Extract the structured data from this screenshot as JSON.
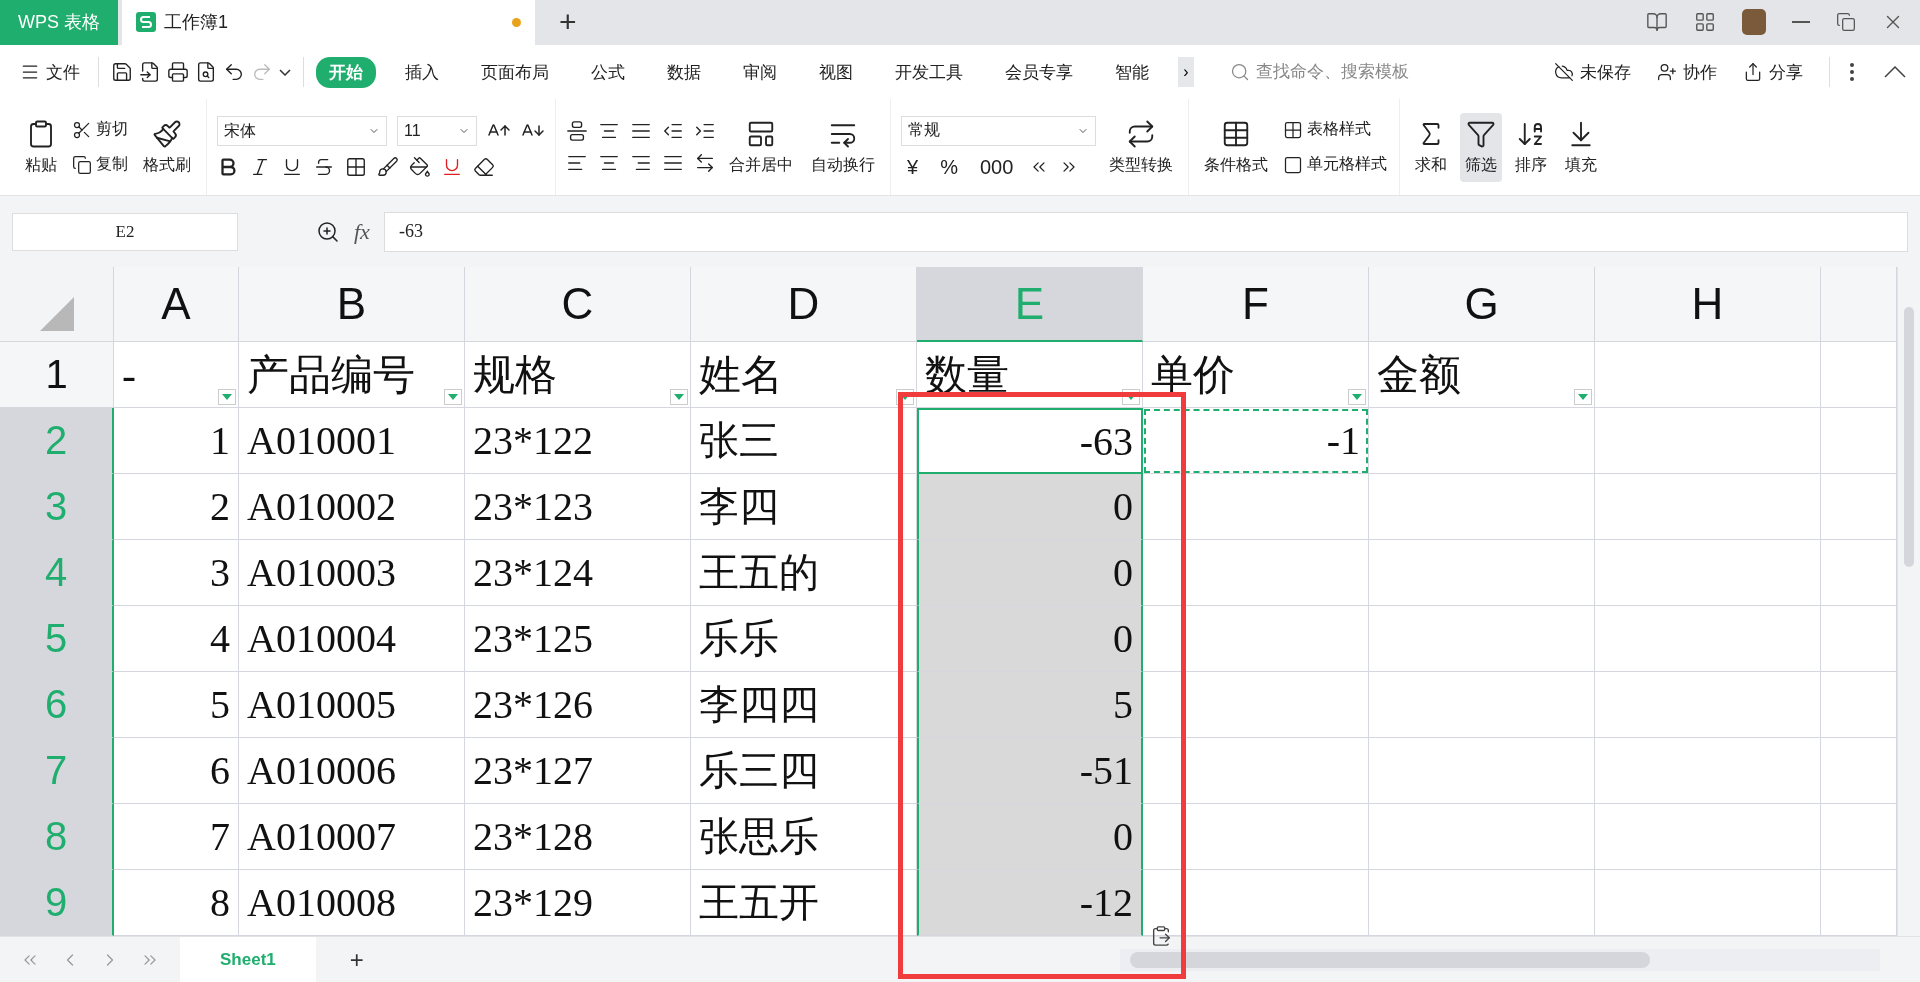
{
  "title_bar": {
    "app_tab": "WPS 表格",
    "doc_tab": {
      "title": "工作簿1",
      "unsaved": true
    },
    "new_tab": "+"
  },
  "menu": {
    "file": "文件",
    "tabs": [
      {
        "label": "开始",
        "selected": true
      },
      {
        "label": "插入",
        "selected": false
      },
      {
        "label": "页面布局",
        "selected": false
      },
      {
        "label": "公式",
        "selected": false
      },
      {
        "label": "数据",
        "selected": false
      },
      {
        "label": "审阅",
        "selected": false
      },
      {
        "label": "视图",
        "selected": false
      },
      {
        "label": "开发工具",
        "selected": false
      },
      {
        "label": "会员专享",
        "selected": false
      },
      {
        "label": "智能",
        "selected": false
      }
    ],
    "more": "›",
    "search": {
      "placeholder": "查找命令、搜索模板"
    },
    "actions": [
      "未保存",
      "协作",
      "分享"
    ]
  },
  "ribbon": {
    "clipboard": {
      "paste": "粘贴",
      "cut": "剪切",
      "copy": "复制",
      "format_painter": "格式刷"
    },
    "font": {
      "name": "宋体",
      "size": "11"
    },
    "alignment": {
      "merge": "合并居中",
      "wrap": "自动换行"
    },
    "number": {
      "format": "常规",
      "currency": "¥",
      "percent": "%",
      "thousands": "000",
      "convert": "类型转换"
    },
    "styles": {
      "conditional": "条件格式",
      "table_style": "表格样式",
      "cell_style": "单元格样式"
    },
    "editing": [
      {
        "label": "求和",
        "selected": false
      },
      {
        "label": "筛选",
        "selected": true
      },
      {
        "label": "排序",
        "selected": false
      },
      {
        "label": "填充",
        "selected": false
      }
    ]
  },
  "formula_bar": {
    "name_box": "E2",
    "fx": "fx",
    "value": "-63"
  },
  "table": {
    "columns": [
      {
        "label": "A",
        "selected": false
      },
      {
        "label": "B",
        "selected": false
      },
      {
        "label": "C",
        "selected": false
      },
      {
        "label": "D",
        "selected": false
      },
      {
        "label": "E",
        "selected": true
      },
      {
        "label": "F",
        "selected": false
      },
      {
        "label": "G",
        "selected": false
      },
      {
        "label": "H",
        "selected": false
      }
    ],
    "header_row": {
      "number": "1",
      "cells": [
        {
          "text": "-",
          "filter": true
        },
        {
          "text": "产品编号",
          "filter": true
        },
        {
          "text": "规格",
          "filter": true
        },
        {
          "text": "姓名",
          "filter": true
        },
        {
          "text": "数量",
          "filter": true
        },
        {
          "text": "单价",
          "filter": true
        },
        {
          "text": "金额",
          "filter": true
        },
        {
          "filter": false
        }
      ]
    },
    "rows": [
      {
        "number": "2",
        "selected": true,
        "cells": [
          {
            "text": "1",
            "kind": "number",
            "selected": false,
            "active": false,
            "copied": false
          },
          {
            "text": "A010001",
            "kind": "text",
            "selected": false,
            "active": false,
            "copied": false
          },
          {
            "text": "23*122",
            "kind": "text",
            "selected": false,
            "active": false,
            "copied": false
          },
          {
            "text": "张三",
            "kind": "text",
            "selected": false,
            "active": false,
            "copied": false
          },
          {
            "text": "-63",
            "kind": "number",
            "selected": true,
            "active": true,
            "copied": false
          },
          {
            "text": "-1",
            "kind": "number",
            "selected": false,
            "active": false,
            "copied": true
          },
          {
            "kind": "text",
            "selected": false,
            "active": false,
            "copied": false
          },
          {
            "kind": "text",
            "selected": false,
            "active": false,
            "copied": false
          }
        ]
      },
      {
        "number": "3",
        "selected": true,
        "cells": [
          {
            "text": "2",
            "kind": "number",
            "selected": false,
            "active": false,
            "copied": false
          },
          {
            "text": "A010002",
            "kind": "text",
            "selected": false,
            "active": false,
            "copied": false
          },
          {
            "text": "23*123",
            "kind": "text",
            "selected": false,
            "active": false,
            "copied": false
          },
          {
            "text": "李四",
            "kind": "text",
            "selected": false,
            "active": false,
            "copied": false
          },
          {
            "text": "0",
            "kind": "number",
            "selected": true,
            "active": false,
            "copied": false
          },
          {
            "kind": "text",
            "selected": false,
            "active": false,
            "copied": false
          },
          {
            "kind": "text",
            "selected": false,
            "active": false,
            "copied": false
          },
          {
            "kind": "text",
            "selected": false,
            "active": false,
            "copied": false
          }
        ]
      },
      {
        "number": "4",
        "selected": true,
        "cells": [
          {
            "text": "3",
            "kind": "number",
            "selected": false,
            "active": false,
            "copied": false
          },
          {
            "text": "A010003",
            "kind": "text",
            "selected": false,
            "active": false,
            "copied": false
          },
          {
            "text": "23*124",
            "kind": "text",
            "selected": false,
            "active": false,
            "copied": false
          },
          {
            "text": "王五的",
            "kind": "text",
            "selected": false,
            "active": false,
            "copied": false
          },
          {
            "text": "0",
            "kind": "number",
            "selected": true,
            "active": false,
            "copied": false
          },
          {
            "kind": "text",
            "selected": false,
            "active": false,
            "copied": false
          },
          {
            "kind": "text",
            "selected": false,
            "active": false,
            "copied": false
          },
          {
            "kind": "text",
            "selected": false,
            "active": false,
            "copied": false
          }
        ]
      },
      {
        "number": "5",
        "selected": true,
        "cells": [
          {
            "text": "4",
            "kind": "number",
            "selected": false,
            "active": false,
            "copied": false
          },
          {
            "text": "A010004",
            "kind": "text",
            "selected": false,
            "active": false,
            "copied": false
          },
          {
            "text": "23*125",
            "kind": "text",
            "selected": false,
            "active": false,
            "copied": false
          },
          {
            "text": "乐乐",
            "kind": "text",
            "selected": false,
            "active": false,
            "copied": false
          },
          {
            "text": "0",
            "kind": "number",
            "selected": true,
            "active": false,
            "copied": false
          },
          {
            "kind": "text",
            "selected": false,
            "active": false,
            "copied": false
          },
          {
            "kind": "text",
            "selected": false,
            "active": false,
            "copied": false
          },
          {
            "kind": "text",
            "selected": false,
            "active": false,
            "copied": false
          }
        ]
      },
      {
        "number": "6",
        "selected": true,
        "cells": [
          {
            "text": "5",
            "kind": "number",
            "selected": false,
            "active": false,
            "copied": false
          },
          {
            "text": "A010005",
            "kind": "text",
            "selected": false,
            "active": false,
            "copied": false
          },
          {
            "text": "23*126",
            "kind": "text",
            "selected": false,
            "active": false,
            "copied": false
          },
          {
            "text": "李四四",
            "kind": "text",
            "selected": false,
            "active": false,
            "copied": false
          },
          {
            "text": "5",
            "kind": "number",
            "selected": true,
            "active": false,
            "copied": false
          },
          {
            "kind": "text",
            "selected": false,
            "active": false,
            "copied": false
          },
          {
            "kind": "text",
            "selected": false,
            "active": false,
            "copied": false
          },
          {
            "kind": "text",
            "selected": false,
            "active": false,
            "copied": false
          }
        ]
      },
      {
        "number": "7",
        "selected": true,
        "cells": [
          {
            "text": "6",
            "kind": "number",
            "selected": false,
            "active": false,
            "copied": false
          },
          {
            "text": "A010006",
            "kind": "text",
            "selected": false,
            "active": false,
            "copied": false
          },
          {
            "text": "23*127",
            "kind": "text",
            "selected": false,
            "active": false,
            "copied": false
          },
          {
            "text": "乐三四",
            "kind": "text",
            "selected": false,
            "active": false,
            "copied": false
          },
          {
            "text": "-51",
            "kind": "number",
            "selected": true,
            "active": false,
            "copied": false
          },
          {
            "kind": "text",
            "selected": false,
            "active": false,
            "copied": false
          },
          {
            "kind": "text",
            "selected": false,
            "active": false,
            "copied": false
          },
          {
            "kind": "text",
            "selected": false,
            "active": false,
            "copied": false
          }
        ]
      },
      {
        "number": "8",
        "selected": true,
        "cells": [
          {
            "text": "7",
            "kind": "number",
            "selected": false,
            "active": false,
            "copied": false
          },
          {
            "text": "A010007",
            "kind": "text",
            "selected": false,
            "active": false,
            "copied": false
          },
          {
            "text": "23*128",
            "kind": "text",
            "selected": false,
            "active": false,
            "copied": false
          },
          {
            "text": "张思乐",
            "kind": "text",
            "selected": false,
            "active": false,
            "copied": false
          },
          {
            "text": "0",
            "kind": "number",
            "selected": true,
            "active": false,
            "copied": false
          },
          {
            "kind": "text",
            "selected": false,
            "active": false,
            "copied": false
          },
          {
            "kind": "text",
            "selected": false,
            "active": false,
            "copied": false
          },
          {
            "kind": "text",
            "selected": false,
            "active": false,
            "copied": false
          }
        ]
      },
      {
        "number": "9",
        "selected": true,
        "cells": [
          {
            "text": "8",
            "kind": "number",
            "selected": false,
            "active": false,
            "copied": false
          },
          {
            "text": "A010008",
            "kind": "text",
            "selected": false,
            "active": false,
            "copied": false
          },
          {
            "text": "23*129",
            "kind": "text",
            "selected": false,
            "active": false,
            "copied": false
          },
          {
            "text": "王五开",
            "kind": "text",
            "selected": false,
            "active": false,
            "copied": false
          },
          {
            "text": "-12",
            "kind": "number",
            "selected": true,
            "active": false,
            "copied": false
          },
          {
            "kind": "text",
            "selected": false,
            "active": false,
            "copied": false
          },
          {
            "kind": "text",
            "selected": false,
            "active": false,
            "copied": false
          },
          {
            "kind": "text",
            "selected": false,
            "active": false,
            "copied": false
          }
        ]
      }
    ]
  },
  "sheet_tabs": {
    "tabs": [
      {
        "label": "Sheet1",
        "selected": true
      }
    ],
    "add": "+"
  }
}
